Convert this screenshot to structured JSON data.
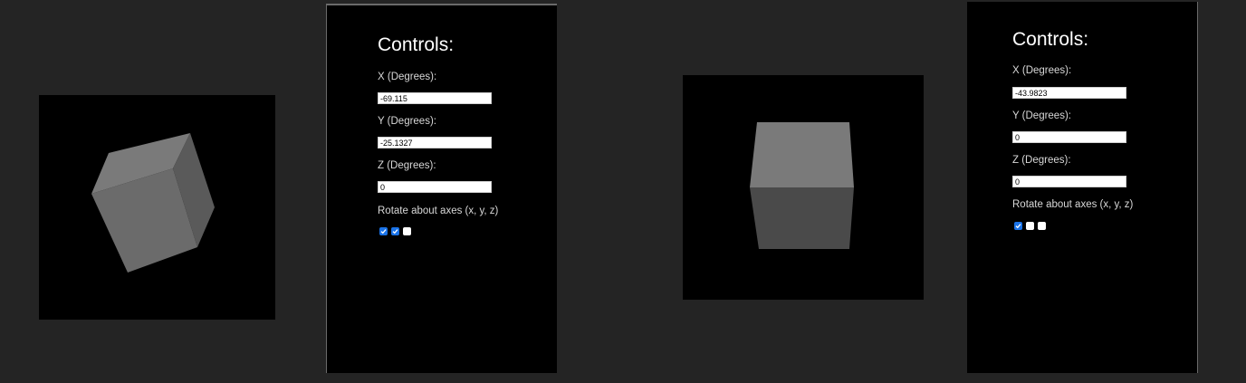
{
  "colors": {
    "page_background": "#242424",
    "panel_background": "#000000",
    "cube_top_face": "#7a7a7a",
    "cube_front_face": "#6b6b6b",
    "cube_side_face": "#5a5a5a",
    "cube_bottom_face": "#4a4a4a",
    "checkbox_checked": "#1a73e8"
  },
  "panels": [
    {
      "title": "Controls:",
      "x_label": "X (Degrees):",
      "x_value": "-69.115",
      "y_label": "Y (Degrees):",
      "y_value": "-25.1327",
      "z_label": "Z (Degrees):",
      "z_value": "0",
      "rotate_label": "Rotate about axes (x, y, z)",
      "axes_checked": [
        true,
        true,
        false
      ]
    },
    {
      "title": "Controls:",
      "x_label": "X (Degrees):",
      "x_value": "-43.9823",
      "y_label": "Y (Degrees):",
      "y_value": "0",
      "z_label": "Z (Degrees):",
      "z_value": "0",
      "rotate_label": "Rotate about axes (x, y, z)",
      "axes_checked": [
        true,
        false,
        false
      ]
    }
  ]
}
